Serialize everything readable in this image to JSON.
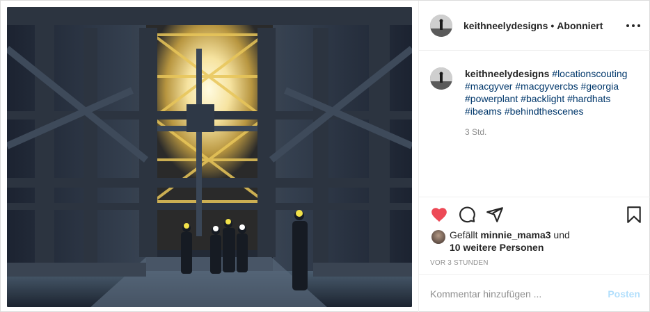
{
  "post": {
    "username": "keithneelydesigns",
    "separator": "•",
    "follow_status": "Abonniert",
    "more_icon": "more-horizontal-icon"
  },
  "caption": {
    "username": "keithneelydesigns",
    "hashtags": [
      "#locationscouting",
      "#macgyver",
      "#macgyvercbs",
      "#georgia",
      "#powerplant",
      "#backlight",
      "#hardhats",
      "#ibeams",
      "#behindthescenes"
    ],
    "time": "3 Std."
  },
  "actions": {
    "like_icon": "heart-filled-icon",
    "like_color": "#ed4956",
    "comment_icon": "comment-icon",
    "share_icon": "share-icon",
    "save_icon": "bookmark-icon"
  },
  "likes": {
    "prefix": "Gefällt",
    "user": "minnie_mama3",
    "connector": "und",
    "others": "10 weitere Personen"
  },
  "post_time": "VOR 3 STUNDEN",
  "comment": {
    "placeholder": "Kommentar hinzufügen ...",
    "post_label": "Posten"
  }
}
